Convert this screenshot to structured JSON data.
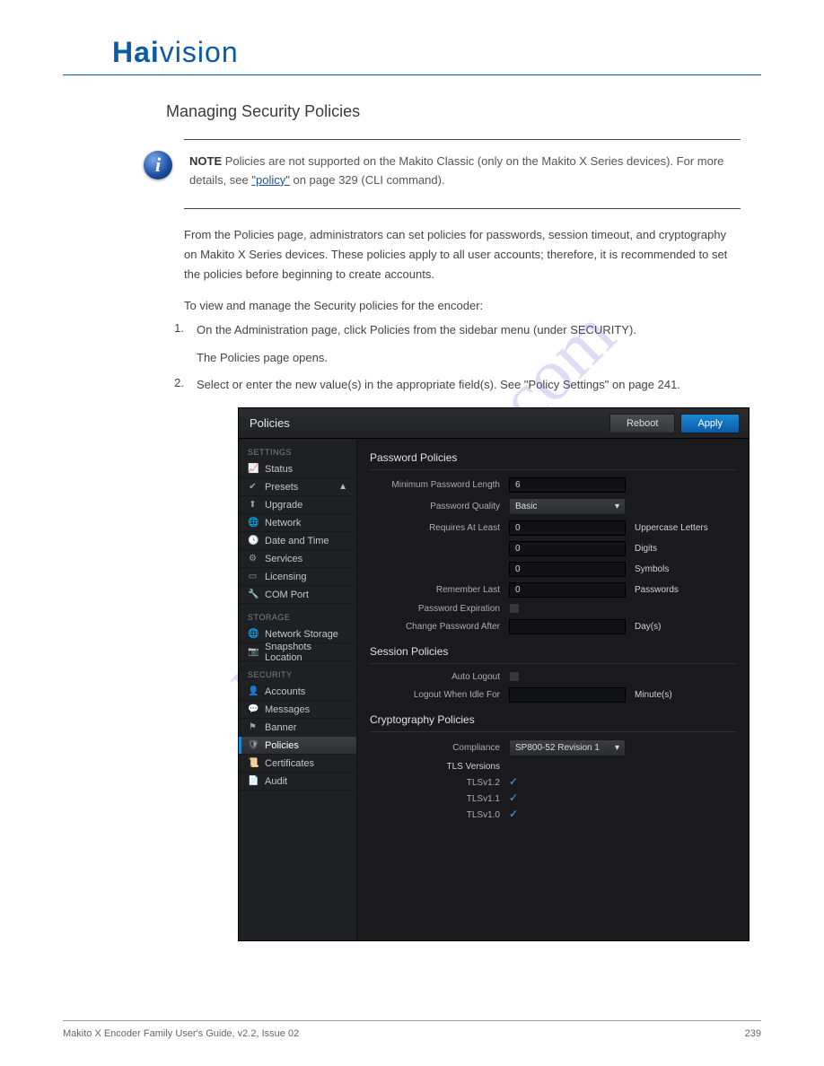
{
  "brand": {
    "part1": "Hai",
    "part2": "vision"
  },
  "section_title": "Managing Security Policies",
  "note": {
    "bold": "NOTE",
    "text_before": "Policies are not supported on the Makito Classic (only on the Makito X Series devices). For more details, see ",
    "link_text": "\"policy\"",
    "text_after": " on page 329 (CLI command)."
  },
  "intro": "From the Policies page, administrators can set policies for passwords, session timeout, and cryptography on Makito X Series devices. These policies apply to all user accounts; therefore, it is recommended to set the policies before beginning to create accounts.",
  "steps": {
    "to_view": "To view and manage the Security policies for the encoder:",
    "s1": "On the Administration page, click Policies from the sidebar menu (under SECURITY).",
    "s1_result": "The Policies page opens.",
    "s2": "Select or enter the new value(s) in the appropriate field(s). See \"Policy Settings\" on page 241."
  },
  "screenshot": {
    "title": "Policies",
    "buttons": {
      "reboot": "Reboot",
      "apply": "Apply"
    },
    "sidebar": {
      "settings_heading": "SETTINGS",
      "storage_heading": "STORAGE",
      "security_heading": "SECURITY",
      "items": {
        "status": "Status",
        "presets": "Presets",
        "upgrade": "Upgrade",
        "network": "Network",
        "datetime": "Date and Time",
        "services": "Services",
        "licensing": "Licensing",
        "comport": "COM Port",
        "netstorage": "Network Storage",
        "snapshots": "Snapshots Location",
        "accounts": "Accounts",
        "messages": "Messages",
        "banner": "Banner",
        "policies": "Policies",
        "certificates": "Certificates",
        "audit": "Audit"
      }
    },
    "sections": {
      "password": {
        "title": "Password Policies",
        "min_len_label": "Minimum Password Length",
        "min_len_value": "6",
        "quality_label": "Password Quality",
        "quality_value": "Basic",
        "requires_label": "Requires At Least",
        "requires_upper_val": "0",
        "requires_upper_suffix": "Uppercase Letters",
        "requires_digits_val": "0",
        "requires_digits_suffix": "Digits",
        "requires_symbols_val": "0",
        "requires_symbols_suffix": "Symbols",
        "remember_label": "Remember Last",
        "remember_val": "0",
        "remember_suffix": "Passwords",
        "expiration_label": "Password Expiration",
        "change_after_label": "Change Password After",
        "change_after_suffix": "Day(s)"
      },
      "session": {
        "title": "Session Policies",
        "auto_logout_label": "Auto Logout",
        "idle_label": "Logout When Idle For",
        "idle_suffix": "Minute(s)"
      },
      "crypto": {
        "title": "Cryptography Policies",
        "compliance_label": "Compliance",
        "compliance_value": "SP800-52 Revision 1",
        "tls_heading": "TLS Versions",
        "tls12": "TLSv1.2",
        "tls11": "TLSv1.1",
        "tls10": "TLSv1.0"
      }
    }
  },
  "footer": {
    "left": "Makito X Encoder Family User's Guide, v2.2, Issue 02",
    "right": "239"
  }
}
